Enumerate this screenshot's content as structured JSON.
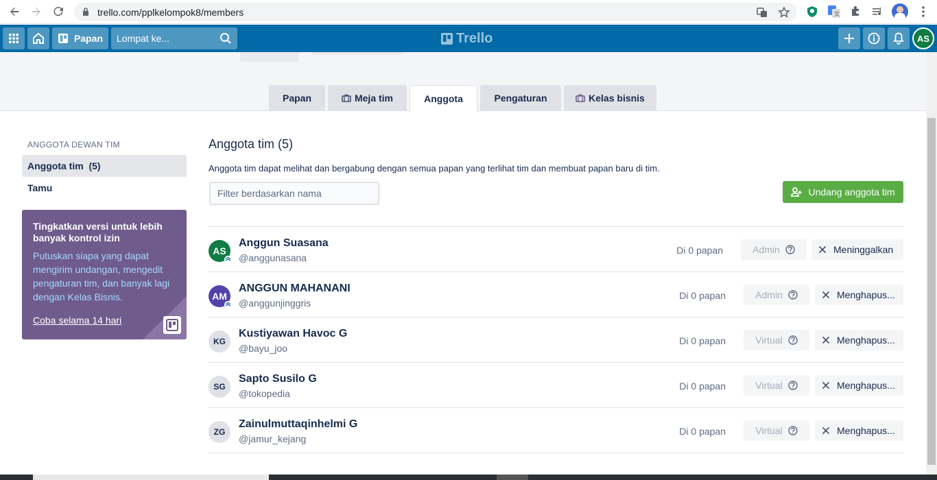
{
  "browser": {
    "url": "trello.com/pplkelompok8/members"
  },
  "header": {
    "boards_label": "Papan",
    "search_placeholder": "Lompat ke...",
    "logo_text": "Trello",
    "user_initials": "AS"
  },
  "tabs": [
    {
      "label": "Papan"
    },
    {
      "label": "Meja tim"
    },
    {
      "label": "Anggota"
    },
    {
      "label": "Pengaturan"
    },
    {
      "label": "Kelas bisnis"
    }
  ],
  "sidebar": {
    "heading": "ANGGOTA DEWAN TIM",
    "items": [
      {
        "label": "Anggota tim",
        "count": "(5)"
      },
      {
        "label": "Tamu"
      }
    ],
    "promo": {
      "title": "Tingkatkan versi untuk lebih banyak kontrol izin",
      "body": "Putuskan siapa yang dapat mengirim undangan, mengedit pengaturan tim, dan banyak lagi dengan Kelas Bisnis.",
      "link": "Coba selama 14 hari"
    }
  },
  "main": {
    "title": "Anggota tim (5)",
    "description": "Anggota tim dapat melihat dan bergabung dengan semua papan yang terlihat tim dan membuat papan baru di tim.",
    "filter_placeholder": "Filter berdasarkan nama",
    "invite_label": "Undang anggota tim"
  },
  "members": [
    {
      "name": "Anggun Suasana",
      "username": "@anggunasana",
      "initials": "AS",
      "avatar_color": "#0f7d44",
      "boards": "Di 0 papan",
      "role": "Admin",
      "action": "Meninggalkan"
    },
    {
      "name": "ANGGUN MAHANANI",
      "username": "@anggunjinggris",
      "initials": "AM",
      "avatar_color": "#5243aa",
      "boards": "Di 0 papan",
      "role": "Admin",
      "action": "Menghapus..."
    },
    {
      "name": "Kustiyawan Havoc G",
      "username": "@bayu_joo",
      "initials": "KG",
      "avatar_color": "#dfe1e6",
      "boards": "Di 0 papan",
      "role": "Virtual",
      "action": "Menghapus..."
    },
    {
      "name": "Sapto Susilo G",
      "username": "@tokopedia",
      "initials": "SG",
      "avatar_color": "#dfe1e6",
      "boards": "Di 0 papan",
      "role": "Virtual",
      "action": "Menghapus..."
    },
    {
      "name": "Zainulmuttaqinhelmi G",
      "username": "@jamur_kejang",
      "initials": "ZG",
      "avatar_color": "#dfe1e6",
      "boards": "Di 0 papan",
      "role": "Virtual",
      "action": "Menghapus..."
    }
  ]
}
